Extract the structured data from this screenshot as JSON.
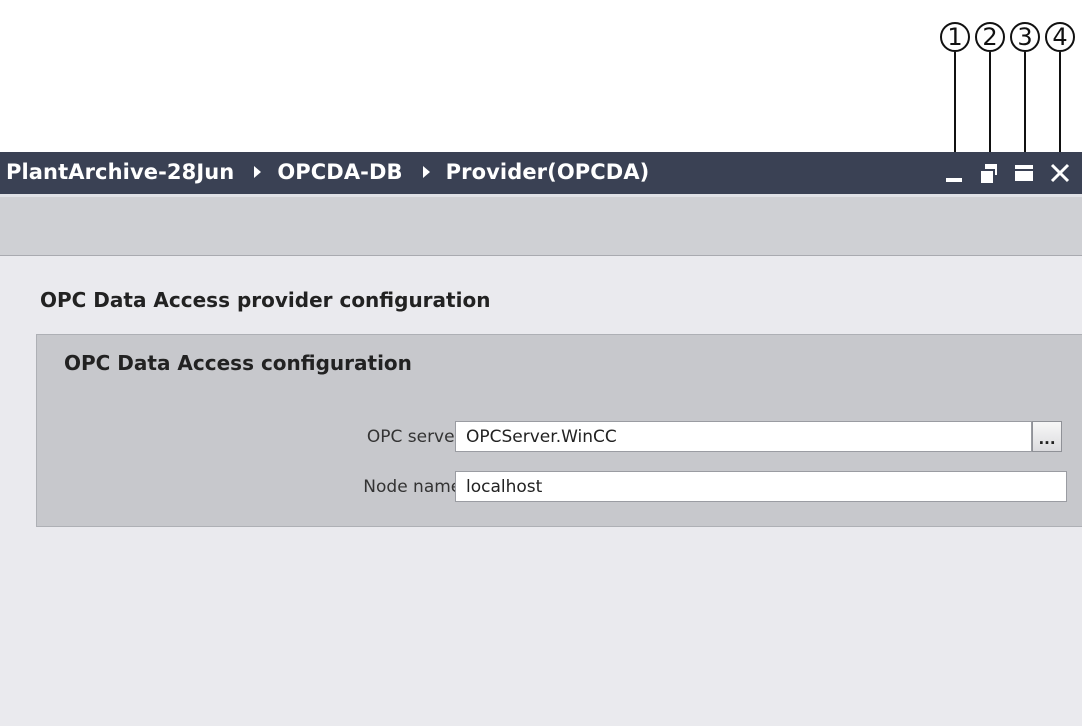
{
  "callouts": [
    "1",
    "2",
    "3",
    "4"
  ],
  "window": {
    "breadcrumb": [
      "PlantArchive-28Jun",
      "OPCDA-DB",
      "Provider(OPCDA)"
    ],
    "controls": [
      "minimize-icon",
      "restore-icon",
      "maximize-icon",
      "close-icon"
    ]
  },
  "main": {
    "section_title": "OPC Data Access provider configuration",
    "group": {
      "title": "OPC Data Access configuration",
      "fields": [
        {
          "label": "OPC server:",
          "value": "OPCServer.WinCC"
        },
        {
          "label": "Node name:",
          "value": "localhost"
        }
      ],
      "browse_label": "..."
    }
  },
  "colors": {
    "titlebar": "#3a4154",
    "toolbar": "#cfd0d4",
    "content": "#eaeaee",
    "group": "#c7c8cc"
  }
}
